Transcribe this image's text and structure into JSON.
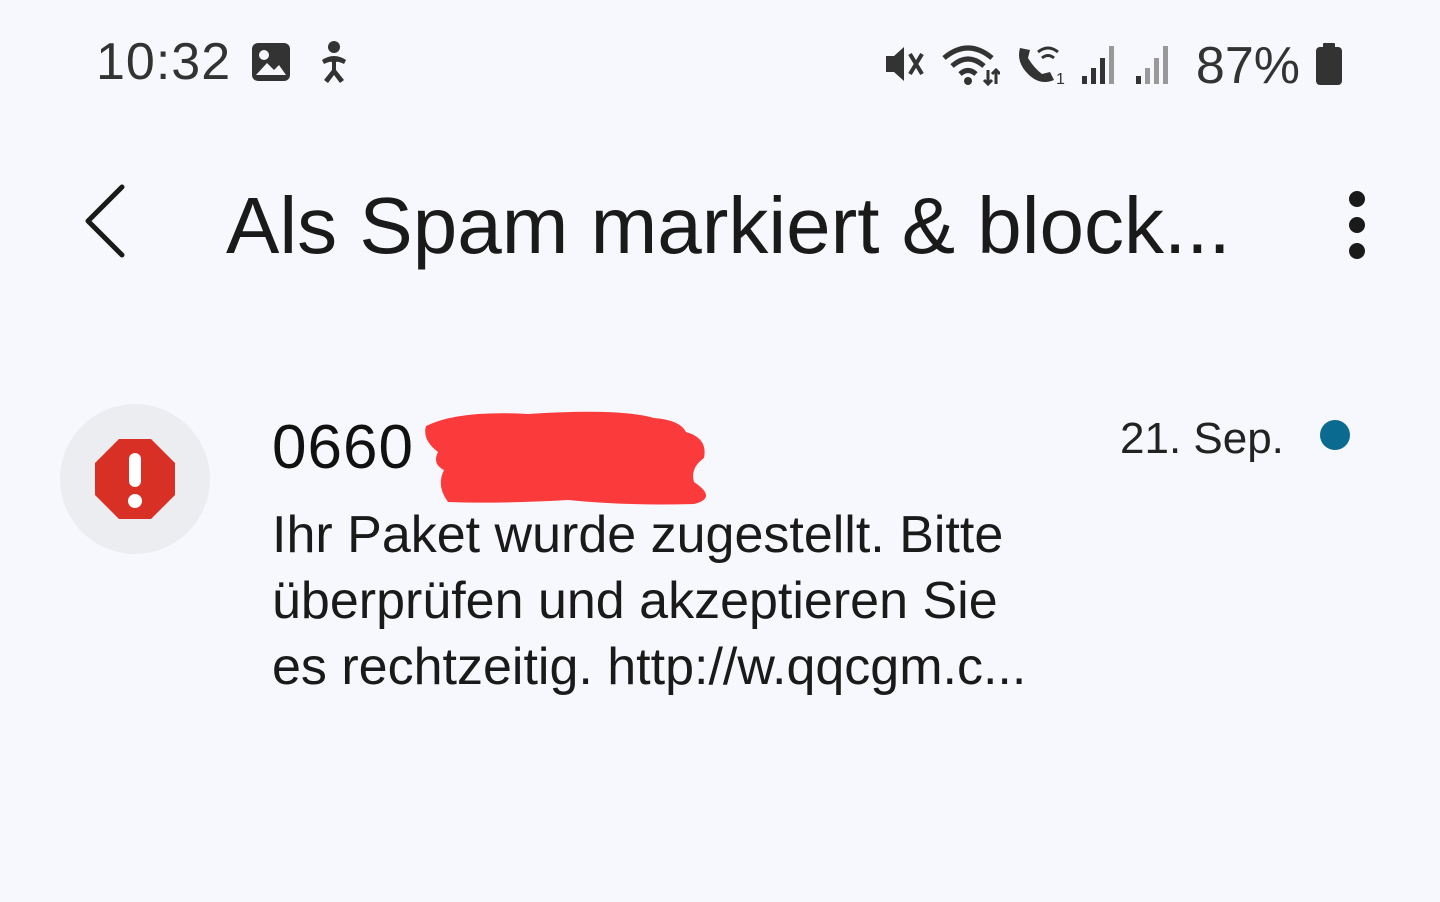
{
  "status_bar": {
    "time": "10:32",
    "battery": "87%",
    "icons_left": [
      "gallery-icon",
      "accessibility-icon"
    ],
    "icons_right": [
      "mute-vibrate-icon",
      "wifi-icon",
      "wifi-call-icon",
      "signal-1-icon",
      "signal-2-icon",
      "battery-icon"
    ]
  },
  "header": {
    "title": "Als Spam markiert & block..."
  },
  "conversation": {
    "sender": "0660",
    "date": "21. Sep.",
    "preview_lines": [
      "Ihr Paket wurde zugestellt. Bitte",
      "überprüfen und akzeptieren Sie",
      "es rechtzeitig. http://w.qqcgm.c..."
    ],
    "unread_color": "#0b6a8f",
    "avatar_icon": "spam-warning-icon",
    "avatar_color": "#d93025"
  }
}
